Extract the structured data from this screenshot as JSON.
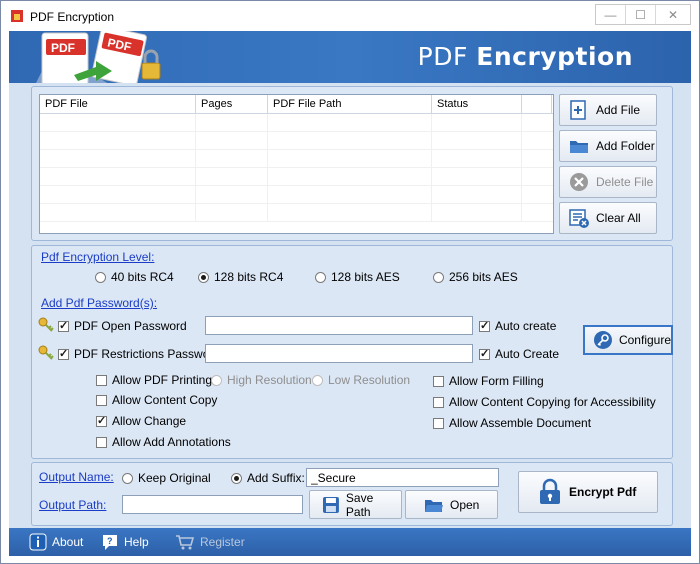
{
  "window": {
    "title": "PDF Encryption",
    "minimize": "—",
    "maximize": "☐",
    "close": "✕"
  },
  "header": {
    "title_part1": "PDF ",
    "title_part2": "Encryption"
  },
  "logo": {
    "badge1": "PDF",
    "badge2": "PDF"
  },
  "files": {
    "columns": [
      "PDF File",
      "Pages",
      "PDF File Path",
      "Status"
    ],
    "rows": []
  },
  "sidebar": {
    "add_file": "Add File",
    "add_folder": "Add Folder",
    "delete_file": "Delete File",
    "clear_all": "Clear All"
  },
  "encryption": {
    "level_label": "Pdf Encryption Level:",
    "levels": [
      "40 bits RC4",
      "128 bits RC4",
      "128 bits AES",
      "256 bits AES"
    ],
    "selected_level": "128 bits RC4",
    "password_label": "Add Pdf Password(s):",
    "open_password_label": "PDF Open Password",
    "open_password_value": "",
    "open_auto_create": "Auto create",
    "restrictions_password_label": "PDF Restrictions Password",
    "restrictions_password_value": "",
    "restrictions_auto_create": "Auto Create",
    "configure": "Configure"
  },
  "permissions": {
    "allow_printing": "Allow PDF Printing",
    "high_resolution": "High Resolution",
    "low_resolution": "Low Resolution",
    "allow_content_copy": "Allow Content Copy",
    "allow_change": "Allow Change",
    "allow_annotations": "Allow Add Annotations",
    "allow_form_filling": "Allow Form Filling",
    "allow_accessibility_copy": "Allow Content Copying for Accessibility",
    "allow_assemble": "Allow Assemble Document"
  },
  "output": {
    "name_label": "Output Name:",
    "keep_original": "Keep Original",
    "add_suffix": "Add Suffix:",
    "suffix_value": "_Secure",
    "path_label": "Output Path:",
    "path_value": "",
    "save_path": "Save Path",
    "open": "Open",
    "encrypt": "Encrypt Pdf"
  },
  "footer": {
    "about": "About",
    "help": "Help",
    "register": "Register"
  },
  "colors": {
    "accent": "#2f69b3",
    "panel": "#dce7f5",
    "link": "#1a3cc6"
  }
}
